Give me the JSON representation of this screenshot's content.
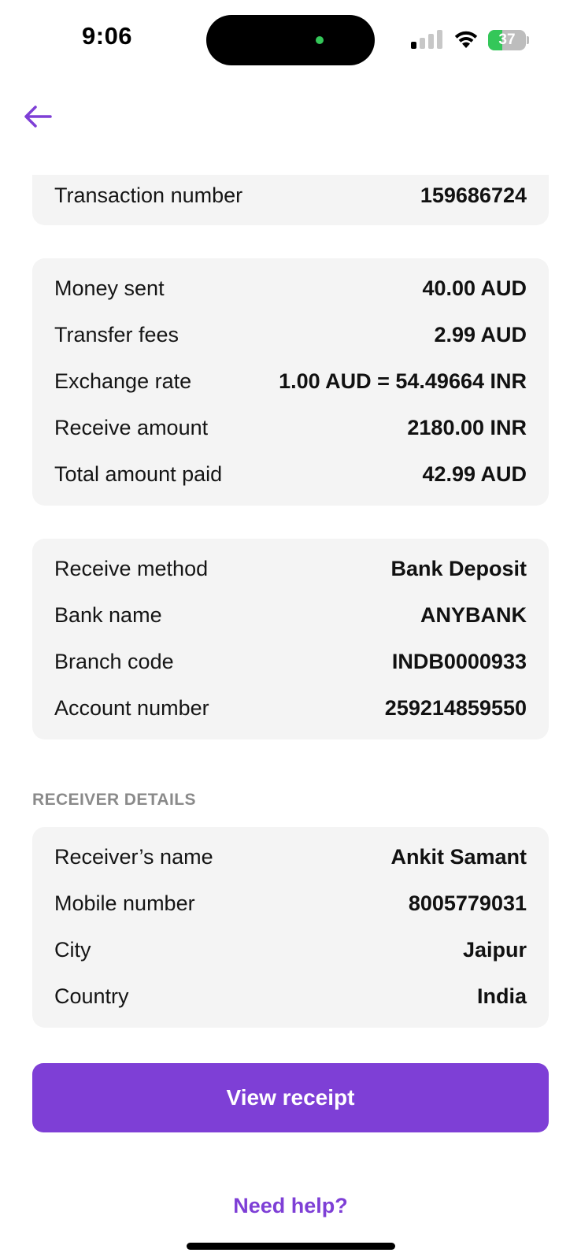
{
  "status_bar": {
    "time": "9:06",
    "battery_percent": 37,
    "battery_label": "37",
    "signal_bars_active": 1,
    "signal_bars_total": 4
  },
  "navigation": {
    "back_icon": "arrow-left-icon"
  },
  "transaction_card": {
    "rows": [
      {
        "label": "Transaction number",
        "value": "159686724"
      }
    ]
  },
  "amount_card": {
    "rows": [
      {
        "label": "Money sent",
        "value": "40.00 AUD"
      },
      {
        "label": "Transfer fees",
        "value": "2.99 AUD"
      },
      {
        "label": "Exchange rate",
        "value": "1.00 AUD = 54.49664 INR"
      },
      {
        "label": "Receive amount",
        "value": "2180.00 INR"
      },
      {
        "label": "Total amount paid",
        "value": "42.99 AUD"
      }
    ]
  },
  "bank_card": {
    "rows": [
      {
        "label": "Receive method",
        "value": "Bank Deposit"
      },
      {
        "label": "Bank name",
        "value": "ANYBANK"
      },
      {
        "label": "Branch code",
        "value": "INDB0000933"
      },
      {
        "label": "Account number",
        "value": "259214859550"
      }
    ]
  },
  "receiver_section": {
    "title": "RECEIVER DETAILS",
    "rows": [
      {
        "label": "Receiver’s name",
        "value": "Ankit Samant"
      },
      {
        "label": "Mobile number",
        "value": "8005779031"
      },
      {
        "label": "City",
        "value": "Jaipur"
      },
      {
        "label": "Country",
        "value": "India"
      }
    ]
  },
  "actions": {
    "view_receipt_label": "View receipt",
    "help_label": "Need help?"
  },
  "colors": {
    "accent": "#7e3fd6",
    "card_background": "#f4f4f4",
    "section_title": "#8a8a8a",
    "battery_green": "#34c759"
  }
}
